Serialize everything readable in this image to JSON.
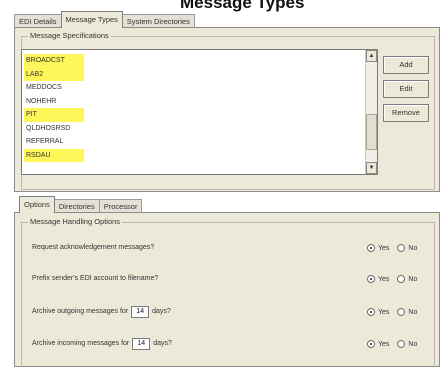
{
  "banner": {
    "title": "Message Types"
  },
  "top_tabs": [
    "EDI Details",
    "Message Types",
    "System Directories"
  ],
  "message_specs": {
    "group_title": "Message Specifications",
    "items": [
      {
        "label": "BROADCST",
        "highlight": true
      },
      {
        "label": "LAB2",
        "highlight": true
      },
      {
        "label": "MEDDOCS",
        "highlight": false
      },
      {
        "label": "NOHEHR",
        "highlight": false
      },
      {
        "label": "PIT",
        "highlight": true
      },
      {
        "label": "QLDHOSRSD",
        "highlight": false
      },
      {
        "label": "REFERRAL",
        "highlight": false
      },
      {
        "label": "RSDAU",
        "highlight": true
      }
    ],
    "highlight_color": "#fff65a"
  },
  "buttons": {
    "add": "Add",
    "edit": "Edit",
    "remove": "Remove"
  },
  "bottom_tabs": [
    "Options",
    "Directories",
    "Processor"
  ],
  "options": {
    "group_title": "Message Handling Options",
    "yes_label": "Yes",
    "no_label": "No",
    "rows": [
      {
        "label": "Request acknowledgement messages?",
        "selected": "yes"
      },
      {
        "label": "Prefix sender's EDI account to filename?",
        "selected": "yes"
      },
      {
        "label_before": "Archive outgoing messages for",
        "days": "14",
        "label_after": "days?",
        "selected": "yes"
      },
      {
        "label_before": "Archive incoming messages for",
        "days": "14",
        "label_after": "days?",
        "selected": "yes"
      }
    ]
  }
}
